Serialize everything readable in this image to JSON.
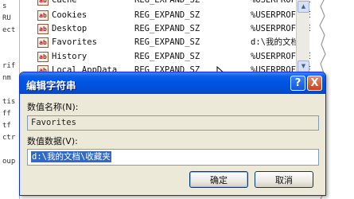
{
  "left_pane": {
    "lines": [
      "s",
      "RU",
      "ect",
      "",
      "",
      "rif",
      "nm",
      "",
      "tis",
      "ff",
      "tf",
      "ctr",
      "",
      "oup"
    ]
  },
  "registry": {
    "rows": [
      {
        "icon": "ab",
        "name": "Cache",
        "type": "REG_EXPAND_SZ",
        "data": "%USERPROFILE"
      },
      {
        "icon": "ab",
        "name": "Cookies",
        "type": "REG_EXPAND_SZ",
        "data": "%USERPROFILE"
      },
      {
        "icon": "ab",
        "name": "Desktop",
        "type": "REG_EXPAND_SZ",
        "data": "%USERPROFILE"
      },
      {
        "icon": "ab",
        "name": "Favorites",
        "type": "REG_EXPAND_SZ",
        "data": "d:\\我的文档\\"
      },
      {
        "icon": "ab",
        "name": "History",
        "type": "REG_EXPAND_SZ",
        "data": "%USERPROFILE"
      },
      {
        "icon": "ab",
        "name": "Local AppData",
        "type": "REG_EXPAND_SZ",
        "data": "%USERPROFILE"
      }
    ]
  },
  "dialog": {
    "title": "编辑字符串",
    "help_symbol": "?",
    "close_symbol": "X",
    "name_label": "数值名称(N):",
    "name_value": "Favorites",
    "data_label": "数值数据(V):",
    "data_value": "d:\\我的文档\\收藏夹",
    "ok_label": "确定",
    "cancel_label": "取消"
  },
  "colors": {
    "titlebar": "#0054e3",
    "dialog_bg": "#ece9d8",
    "selection": "#316ac5"
  }
}
